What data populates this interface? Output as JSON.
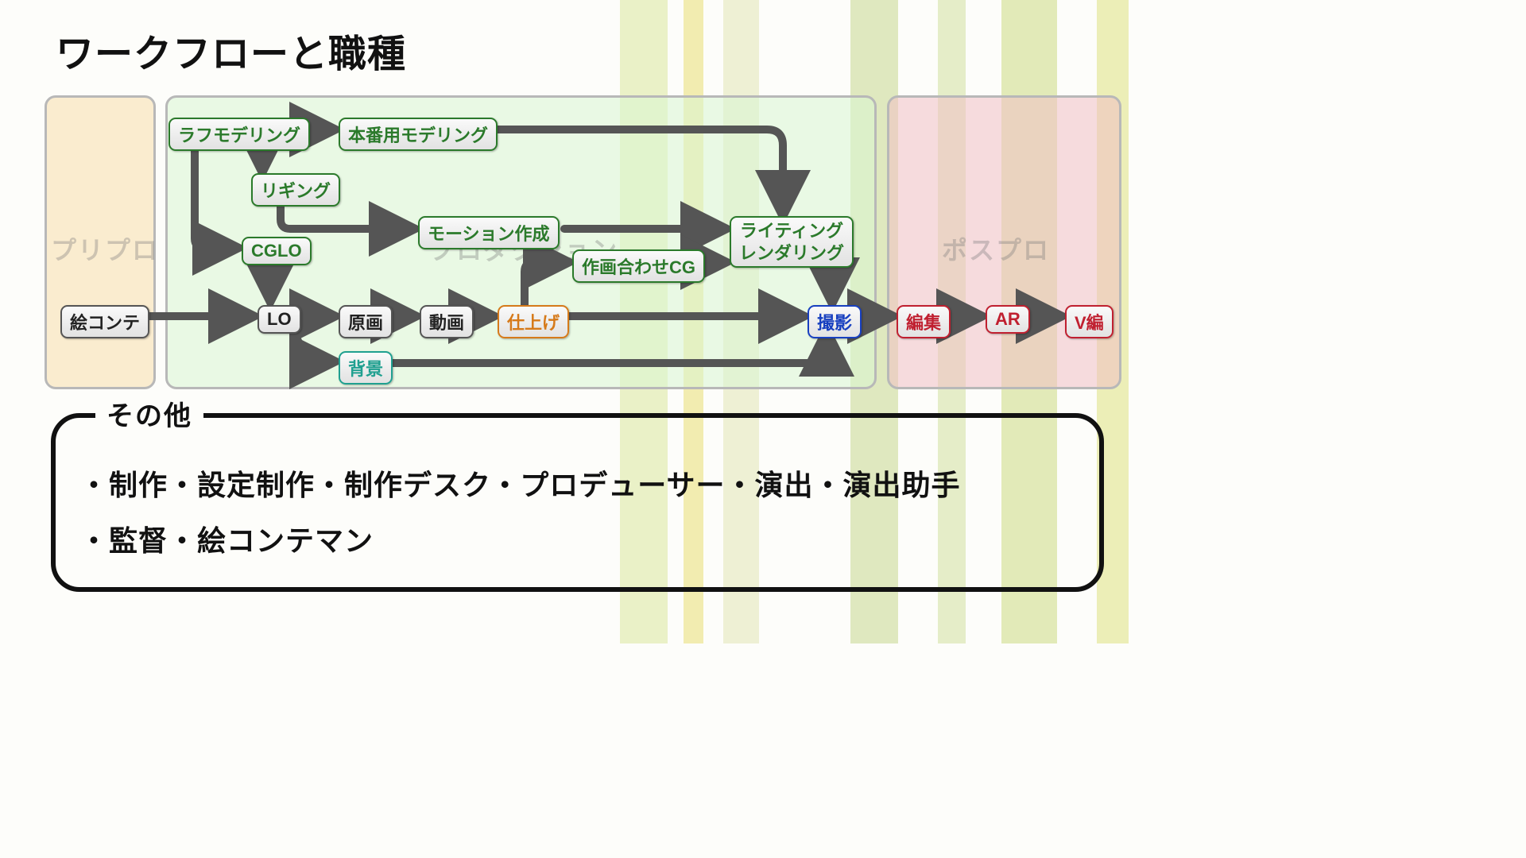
{
  "title": "ワークフローと職種",
  "panels": {
    "pre": "プリプロ",
    "prod": "プロダクション",
    "post": "ポスプロ"
  },
  "nodes": {
    "econte": "絵コンテ",
    "rough_model": "ラフモデリング",
    "final_model": "本番用モデリング",
    "rigging": "リギング",
    "cglo": "CGLO",
    "motion": "モーション作成",
    "sakuga_cg": "作画合わせCG",
    "lighting": "ライティング\nレンダリング",
    "lo": "LO",
    "genga": "原画",
    "douga": "動画",
    "shiage": "仕上げ",
    "haikei": "背景",
    "satsuei": "撮影",
    "henshu": "編集",
    "ar": "AR",
    "vhen": "V編"
  },
  "others": {
    "label": "その他",
    "line1": "・制作・設定制作・制作デスク・プロデューサー・演出・演出助手",
    "line2": "・監督・絵コンテマン"
  }
}
